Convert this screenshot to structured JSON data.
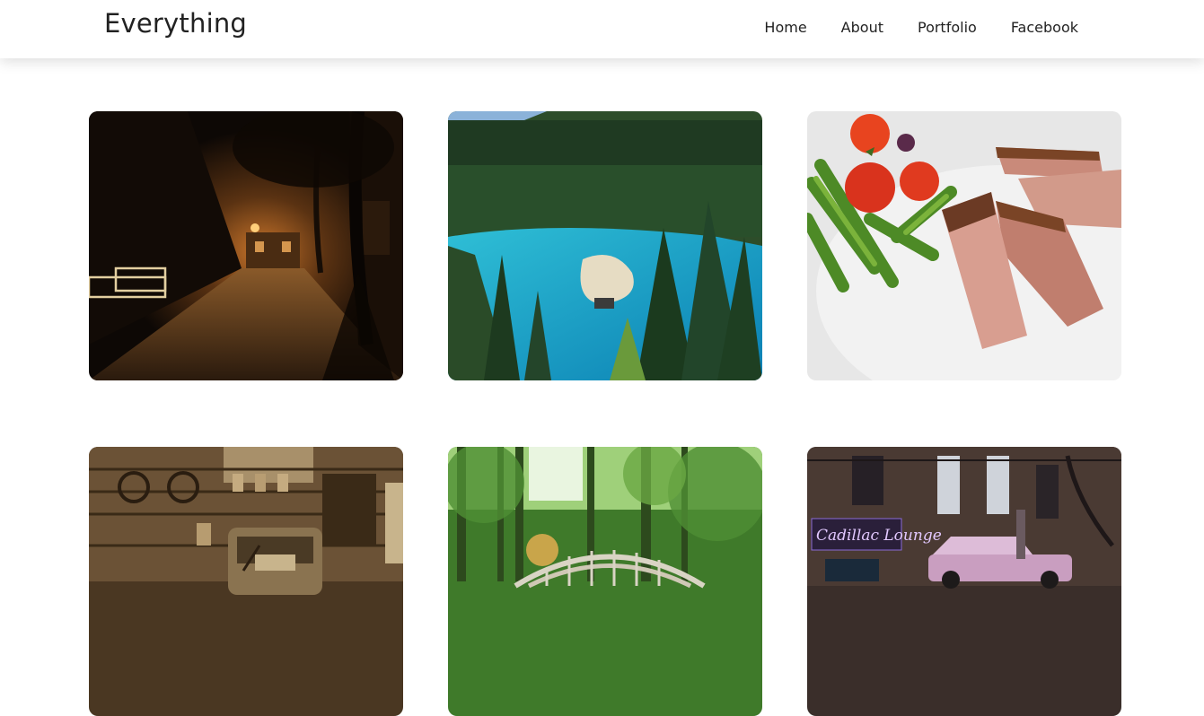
{
  "header": {
    "brand": "Everything",
    "nav": [
      "Home",
      "About",
      "Portfolio",
      "Facebook"
    ]
  },
  "gallery": {
    "photos": [
      "night-cobblestone-street",
      "mountain-lake-forest",
      "steak-asparagus-tomatoes",
      "vintage-garage-sepia",
      "forest-wooden-bridge",
      "neon-lounge-vintage-car"
    ],
    "signage_text": "Cadillac Lounge"
  }
}
